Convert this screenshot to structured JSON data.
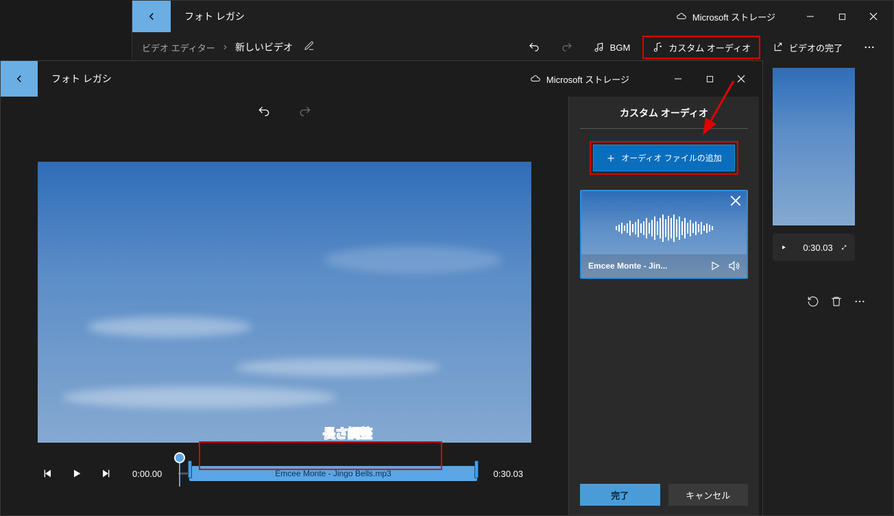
{
  "app_title": "フォト レガシ",
  "storage_label": "Microsoft ストレージ",
  "breadcrumb": "ビデオ エディター",
  "project_name": "新しいビデオ",
  "toolbar": {
    "bgm": "BGM",
    "custom_audio": "カスタム オーディオ",
    "finish": "ビデオの完了"
  },
  "back_timeline": {
    "duration": "0:30.03"
  },
  "front": {
    "app_title": "フォト レガシ",
    "storage_label": "Microsoft ストレージ",
    "annotation": "長さ調整",
    "timeline": {
      "current": "0:00.00",
      "end": "0:30.03",
      "clip_label": "Emcee Monte - Jingo Bells.mp3"
    }
  },
  "side": {
    "title": "カスタム オーディオ",
    "add_label": "オーディオ ファイルの追加",
    "card_title": "Emcee Monte - Jin...",
    "done": "完了",
    "cancel": "キャンセル"
  }
}
